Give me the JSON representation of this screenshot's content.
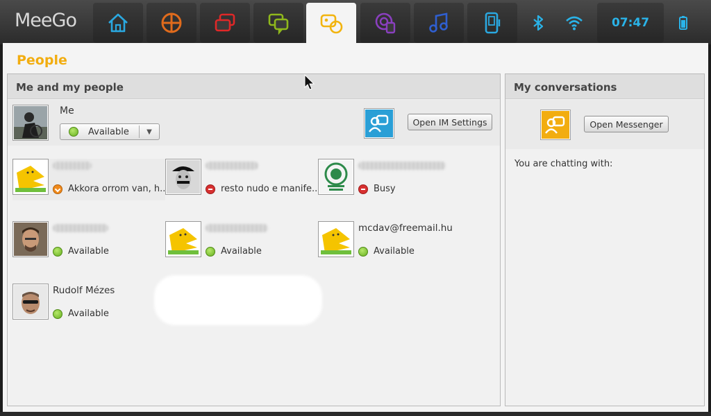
{
  "topbar": {
    "logo": "MeeGo",
    "zones": [
      {
        "name": "home-icon",
        "color": "#2aa8e0"
      },
      {
        "name": "applications-icon",
        "color": "#e06b1c"
      },
      {
        "name": "zones-icon",
        "color": "#e02828"
      },
      {
        "name": "status-icon",
        "color": "#8fb81c"
      },
      {
        "name": "people-icon",
        "color": "#f2b40f"
      },
      {
        "name": "internet-icon",
        "color": "#8a3fbf"
      },
      {
        "name": "media-icon",
        "color": "#2f5fd0"
      },
      {
        "name": "devices-icon",
        "color": "#2aa8e0"
      }
    ],
    "clock": "07:47"
  },
  "window": {
    "title": "People"
  },
  "people_panel": {
    "heading": "Me and my people",
    "me": {
      "name": "Me",
      "status": "Available",
      "im_settings_button": "Open IM Settings"
    },
    "contacts": [
      {
        "name": "",
        "status": "Akkora orrom van, h...",
        "presence": "orange"
      },
      {
        "name": "",
        "status": "resto nudo e manife...",
        "presence": "red"
      },
      {
        "name": "",
        "status": "Busy",
        "presence": "red"
      },
      {
        "name": "",
        "status": "Available",
        "presence": "green"
      },
      {
        "name": "",
        "status": "Available",
        "presence": "green"
      },
      {
        "name": "mcdav@freemail.hu",
        "status": "Available",
        "presence": "green"
      },
      {
        "name": "Rudolf Mézes",
        "status": "Available",
        "presence": "green"
      }
    ]
  },
  "conversations_panel": {
    "heading": "My conversations",
    "messenger_button": "Open Messenger",
    "chatting_with": "You are chatting with:"
  },
  "colors": {
    "accent": "#f2ad10",
    "clock": "#2ab3e8",
    "available": "#67b021",
    "busy": "#d73030",
    "away": "#f08a1c"
  }
}
